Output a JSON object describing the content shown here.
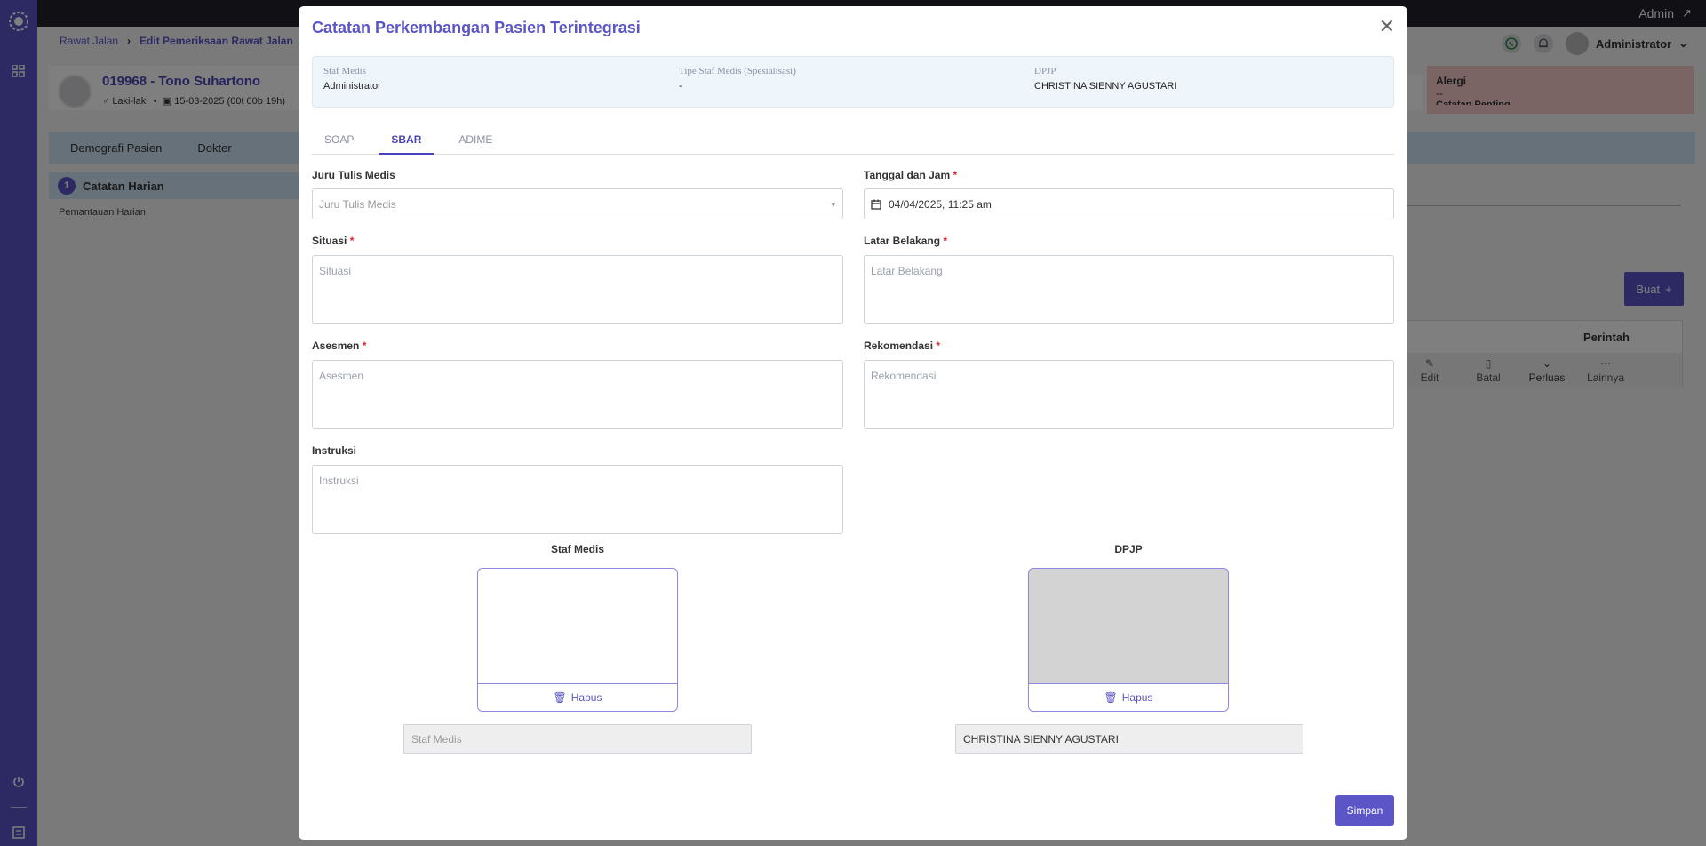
{
  "topbar": {
    "user_link": "Admin"
  },
  "breadcrumb": {
    "items": [
      "Rawat Jalan",
      "Edit Pemeriksaan Rawat Jalan"
    ]
  },
  "header": {
    "user_name": "Administrator"
  },
  "patient": {
    "title": "019968 - Tono Suhartono",
    "gender": "Laki-laki",
    "dob": "15-03-2025 (00t 00b 19h)"
  },
  "alergi": {
    "title": "Alergi",
    "value": "--",
    "extra": "Catatan Penting"
  },
  "page_tabs": [
    "Demografi Pasien",
    "Dokter"
  ],
  "sidebar_menu": {
    "active_number": "1",
    "active_label": "Catatan Harian",
    "sub_label": "Pemantauan Harian"
  },
  "right_panel": {
    "buat_label": "Buat",
    "perintah_title": "Perintah",
    "actions": [
      "Edit",
      "Batal",
      "Perluas",
      "Lainnya"
    ]
  },
  "modal": {
    "title": "Catatan Perkembangan Pasien Terintegrasi",
    "info": {
      "staf_medis_label": "Staf Medis",
      "staf_medis_value": "Administrator",
      "tipe_label": "Tipe Staf Medis (Spesialisasi)",
      "tipe_value": "-",
      "dpjp_label": "DPJP",
      "dpjp_value": "CHRISTINA SIENNY AGUSTARI"
    },
    "tabs": [
      {
        "label": "SOAP",
        "active": false
      },
      {
        "label": "SBAR",
        "active": true
      },
      {
        "label": "ADIME",
        "active": false
      }
    ],
    "form": {
      "juru_tulis_label": "Juru Tulis Medis",
      "juru_tulis_placeholder": "Juru Tulis Medis",
      "tanggal_label": "Tanggal dan Jam",
      "tanggal_value": "04/04/2025, 11:25 am",
      "situasi_label": "Situasi",
      "situasi_placeholder": "Situasi",
      "latar_label": "Latar Belakang",
      "latar_placeholder": "Latar Belakang",
      "asesmen_label": "Asesmen",
      "asesmen_placeholder": "Asesmen",
      "rekomendasi_label": "Rekomendasi",
      "rekomendasi_placeholder": "Rekomendasi",
      "instruksi_label": "Instruksi",
      "instruksi_placeholder": "Instruksi"
    },
    "signatures": {
      "staf_title": "Staf Medis",
      "dpjp_title": "DPJP",
      "hapus_label": "Hapus",
      "staf_name_placeholder": "Staf Medis",
      "dpjp_name_value": "CHRISTINA SIENNY AGUSTARI"
    },
    "simpan_label": "Simpan"
  },
  "colors": {
    "primary": "#5b55c7",
    "required": "#e0262c",
    "info_bg": "#eef5fb",
    "alert_bg": "#f7c9c9"
  }
}
